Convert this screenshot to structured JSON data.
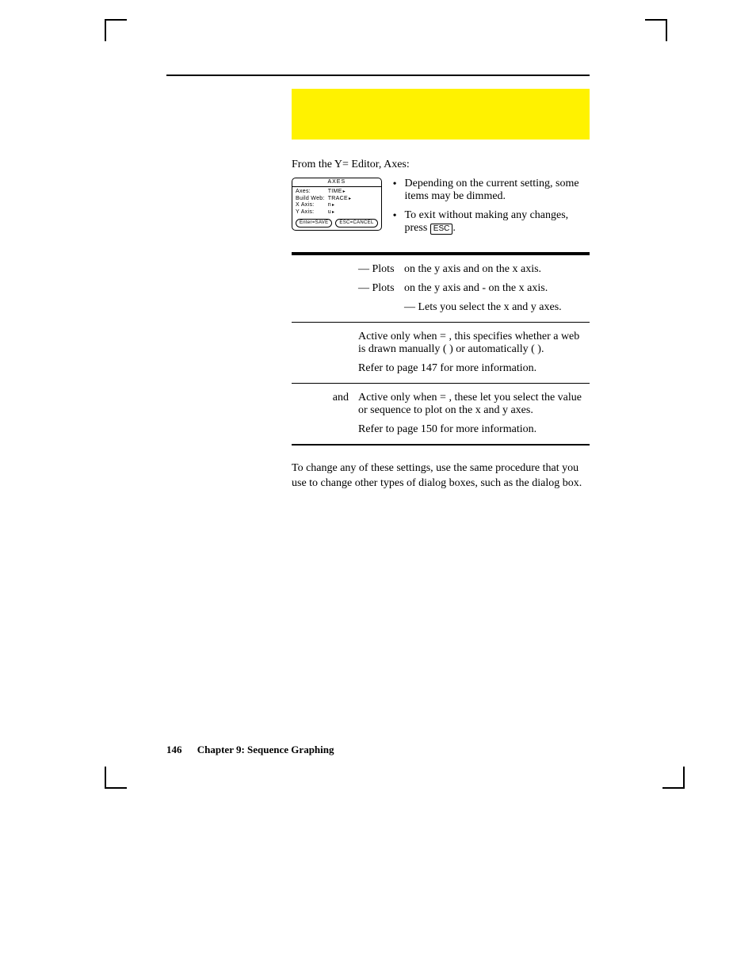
{
  "intro": "From the Y= Editor, Axes:",
  "dialog": {
    "title": "AXES",
    "labels": [
      "Axes:",
      "Build Web:",
      "X Axis:",
      "Y Axis:"
    ],
    "values": [
      "TIME",
      "TRACE",
      "n",
      "u"
    ],
    "btn_ok": "Enter=SAVE",
    "btn_cancel": "ESC=CANCEL"
  },
  "bullets": [
    "Depending on the current setting, some items may be dimmed.",
    "To exit without making any changes, press "
  ],
  "esc_key": "ESC",
  "rows": {
    "r1": {
      "p1a": "— Plots ",
      "p1b": " on the y axis and ",
      "p1c": " on the x axis.",
      "p2a": "— Plots ",
      "p2b": " on the y axis and ",
      "p2c": " - ",
      "p2d": " on the x axis.",
      "p3": "— Lets you select the x and y axes."
    },
    "r2": {
      "p1a": "Active only when ",
      "p1b": " = ",
      "p1c": ", this specifies whether a web is drawn manually (",
      "p1d": ") or automatically (",
      "p1e": ").",
      "p2": "Refer to page 147 for more information."
    },
    "r3": {
      "label": " and ",
      "p1a": "Active only when ",
      "p1b": " = ",
      "p1c": ", these let you select the value or sequence to plot on the x and y axes.",
      "p2": "Refer to page 150 for more information."
    }
  },
  "closing": {
    "a": "To change any of these settings, use the same procedure that you use to change other types of dialog boxes, such as the ",
    "b": " dialog box."
  },
  "footer": {
    "page": "146",
    "chapter": "Chapter 9: Sequence Graphing"
  }
}
